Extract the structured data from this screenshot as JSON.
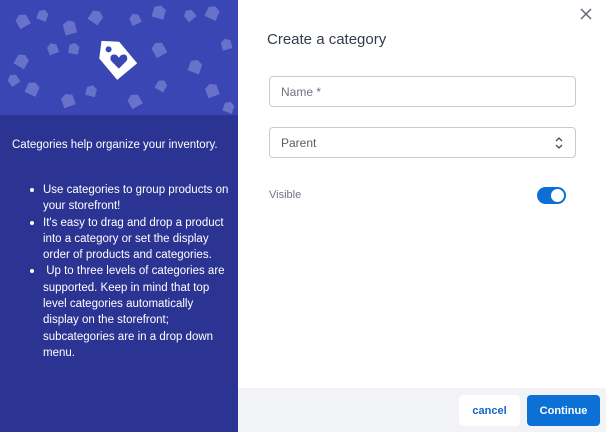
{
  "info_panel": {
    "intro": "Categories help organize your inventory.",
    "bullets": [
      "Use categories to group products on your storefront!",
      "It's easy to drag and drop a product into a category or set the display order of products and categories.",
      " Up to three levels of categories are supported. Keep in mind that top level categories automatically display on the storefront; subcategories are in a drop down menu."
    ],
    "hero_icon": "tag-heart-icon"
  },
  "dialog": {
    "title": "Create a category",
    "close_icon": "close-icon",
    "name_field": {
      "placeholder": "Name *",
      "value": ""
    },
    "parent_select": {
      "value": "Parent"
    },
    "visible": {
      "label": "Visible",
      "on": true
    }
  },
  "footer": {
    "cancel_label": "cancel",
    "continue_label": "Continue"
  },
  "colors": {
    "panel_bg": "#2b3492",
    "hero_bg": "#3a46b3",
    "accent": "#0c70d6"
  }
}
